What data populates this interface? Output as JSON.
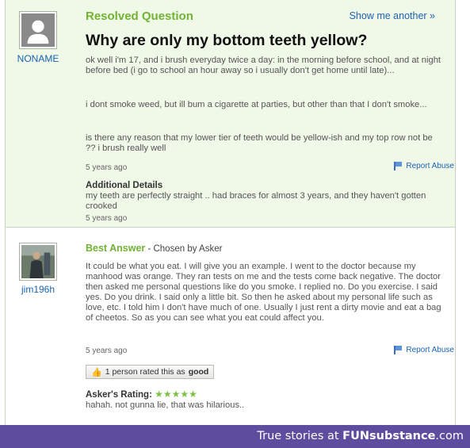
{
  "question": {
    "status": "Resolved Question",
    "show_another": "Show me another »",
    "title": "Why are only my bottom teeth yellow?",
    "username": "NONAME",
    "paragraphs": [
      "ok well i'm 17, and i brush everyday twice a day: in the morning before school, and at night before bed (i go to school an hour away so i usually don't get home until late)...",
      "i dont smoke weed, but ill bum a cigarette at parties, but other than that I don't smoke...",
      "is there any reason that my lower tier of teeth would be yellow-ish and my top row not be ?? i brush really well"
    ],
    "timestamp": "5 years ago",
    "report_abuse": "Report Abuse",
    "additional_details_label": "Additional Details",
    "additional_details_text": "my teeth are perfectly straight .. had braces for almost 3 years, and they haven't gotten crooked",
    "additional_timestamp": "5 years ago"
  },
  "answer": {
    "username": "jim196h",
    "best_answer_label": "Best Answer",
    "chosen_by": " - Chosen by Asker",
    "text": "It could be what you eat. I will give you an example. I went to the doctor because my manhood was orange. They ran tests on me and the tests come back negative. The doctor then asked me personal questions like do you smoke. I replied no. Do you exercise. I said yes. Do you drink. I said only a little bit. So then he asked about my personal life such as love, etc. I told him I don't have much of one. Usually I just rent a dirty movie and eat a bag of cheetos. So as you can see what you eat could affect you.",
    "timestamp": "5 years ago",
    "report_abuse": "Report Abuse",
    "rated_prefix": "1 person rated this as ",
    "rated_value": "good",
    "asker_rating_label": "Asker's Rating: ",
    "asker_rating_stars": "★★★★★",
    "asker_rating_value": 5,
    "asker_comment": "hahah. not gunna lie, that was hilarious.."
  },
  "footer": {
    "prefix": "True stories at ",
    "brand": "FUNsubstance",
    "suffix": ".com"
  },
  "colors": {
    "green_accent": "#71b333",
    "link_blue": "#1b62b3",
    "question_bg": "#f0f8e8",
    "footer_purple": "#5e4c9e"
  }
}
